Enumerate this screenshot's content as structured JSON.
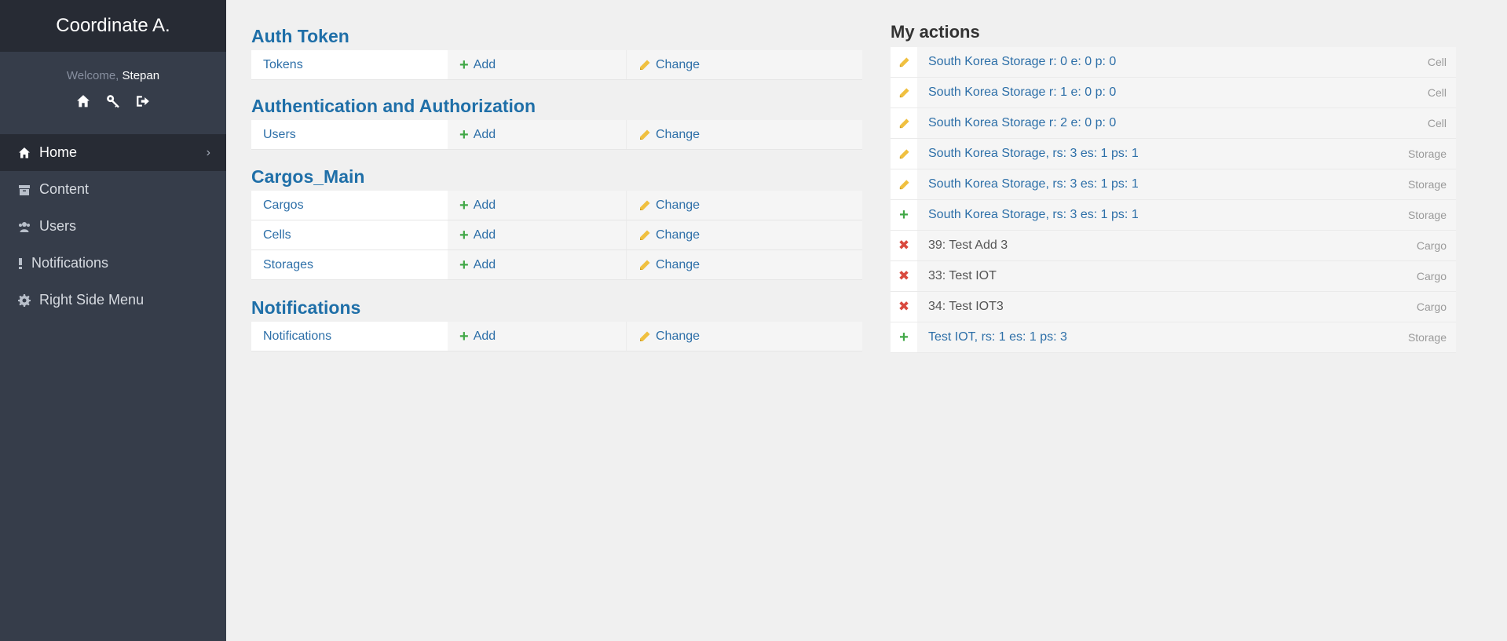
{
  "sidebar": {
    "brand": "Coordinate A.",
    "welcome": "Welcome,",
    "username": "Stepan",
    "tools": [
      "home-icon",
      "key-icon",
      "logout-icon"
    ],
    "nav": [
      {
        "label": "Home",
        "icon": "home-icon",
        "active": true
      },
      {
        "label": "Content",
        "icon": "archive-icon",
        "active": false
      },
      {
        "label": "Users",
        "icon": "users-icon",
        "active": false
      },
      {
        "label": "Notifications",
        "icon": "exclamation-icon",
        "active": false
      },
      {
        "label": "Right Side Menu",
        "icon": "gear-icon",
        "active": false
      }
    ]
  },
  "modules": [
    {
      "title": "Auth Token",
      "rows": [
        {
          "model": "Tokens",
          "add": "Add",
          "change": "Change"
        }
      ]
    },
    {
      "title": "Authentication and Authorization",
      "rows": [
        {
          "model": "Users",
          "add": "Add",
          "change": "Change"
        }
      ]
    },
    {
      "title": "Cargos_Main",
      "rows": [
        {
          "model": "Cargos",
          "add": "Add",
          "change": "Change"
        },
        {
          "model": "Cells",
          "add": "Add",
          "change": "Change"
        },
        {
          "model": "Storages",
          "add": "Add",
          "change": "Change"
        }
      ]
    },
    {
      "title": "Notifications",
      "rows": [
        {
          "model": "Notifications",
          "add": "Add",
          "change": "Change"
        }
      ]
    }
  ],
  "recent_actions": {
    "title": "My actions",
    "items": [
      {
        "action": "change",
        "text": "South Korea Storage r: 0 e: 0 p: 0",
        "type": "Cell"
      },
      {
        "action": "change",
        "text": "South Korea Storage r: 1 e: 0 p: 0",
        "type": "Cell"
      },
      {
        "action": "change",
        "text": "South Korea Storage r: 2 e: 0 p: 0",
        "type": "Cell"
      },
      {
        "action": "change",
        "text": "South Korea Storage, rs: 3 es: 1 ps: 1",
        "type": "Storage"
      },
      {
        "action": "change",
        "text": "South Korea Storage, rs: 3 es: 1 ps: 1",
        "type": "Storage"
      },
      {
        "action": "add",
        "text": "South Korea Storage, rs: 3 es: 1 ps: 1",
        "type": "Storage"
      },
      {
        "action": "delete",
        "text": "39: Test Add 3",
        "type": "Cargo"
      },
      {
        "action": "delete",
        "text": "33: Test IOT",
        "type": "Cargo"
      },
      {
        "action": "delete",
        "text": "34: Test IOT3",
        "type": "Cargo"
      },
      {
        "action": "add",
        "text": "Test IOT, rs: 1 es: 1 ps: 3",
        "type": "Storage"
      }
    ]
  },
  "colors": {
    "sidebar_bg": "#363d4a",
    "sidebar_header_bg": "#272b34",
    "link": "#2d6fa8",
    "module_title": "#1f6fa8",
    "add_green": "#41a847",
    "change_yellow": "#f0c040",
    "delete_red": "#d9493e"
  }
}
